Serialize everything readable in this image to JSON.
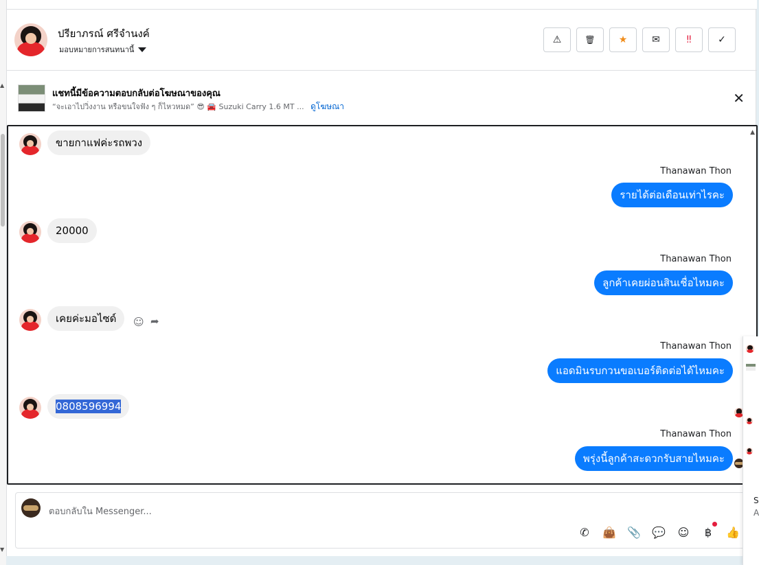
{
  "header": {
    "contact_name": "ปรียาภรณ์ ศรีจำนงค์",
    "assign_label": "มอบหมายการสนทนานี้",
    "actions": [
      {
        "name": "report-spam-icon",
        "glyph": "⚠"
      },
      {
        "name": "trash-icon",
        "glyph": "🗑"
      },
      {
        "name": "star-icon",
        "glyph": "★"
      },
      {
        "name": "mark-unread-icon",
        "glyph": "✉"
      },
      {
        "name": "follow-up-icon",
        "glyph": "‼"
      },
      {
        "name": "mark-done-icon",
        "glyph": "✓"
      }
    ]
  },
  "ad_banner": {
    "title": "แชทนี้มีข้อความตอบกลับต่อโฆษณาของคุณ",
    "subtitle": "“จะเอาไปวิ่งงาน หรือขนใจฟัง ๆ ก็ไหวหมด” 😎 🚘 Suzuki Carry 1.6 MT ...",
    "link_label": "ดูโฆษณา",
    "close_glyph": "✕"
  },
  "messages": [
    {
      "direction": "in",
      "text": "ขายกาแฟค่ะรถพวง"
    },
    {
      "direction": "out",
      "sender": "Thanawan Thon",
      "text": "รายได้ต่อเดือนเท่าไรคะ"
    },
    {
      "direction": "in",
      "text": "20000"
    },
    {
      "direction": "out",
      "sender": "Thanawan Thon",
      "text": "ลูกค้าเคยผ่อนสินเชื่อไหมคะ"
    },
    {
      "direction": "in",
      "text": "เคยค่ะมอไซด์"
    },
    {
      "direction": "out",
      "sender": "Thanawan Thon",
      "text": "แอดมินรบกวนขอเบอร์ติดต่อได้ไหมคะ"
    },
    {
      "direction": "in",
      "text": "0808596994"
    },
    {
      "direction": "out",
      "sender": "Thanawan Thon",
      "text": "พรุ่งนี้ลูกค้าสะดวกรับสายไหมคะ"
    }
  ],
  "reactions": {
    "emoji_glyph": "☺",
    "reply_glyph": "➦"
  },
  "composer": {
    "placeholder": "ตอบกลับใน Messenger...",
    "tools": [
      {
        "name": "add-call-icon",
        "glyph": "✆"
      },
      {
        "name": "shopping-bag-icon",
        "glyph": "👜"
      },
      {
        "name": "attachment-icon",
        "glyph": "📎"
      },
      {
        "name": "saved-reply-icon",
        "glyph": "💬"
      },
      {
        "name": "emoji-icon",
        "glyph": "☺"
      },
      {
        "name": "payment-baht-icon",
        "glyph": "฿"
      },
      {
        "name": "like-icon",
        "glyph": "👍"
      }
    ]
  },
  "side_panel": {
    "line1": "S",
    "line2": "A"
  }
}
